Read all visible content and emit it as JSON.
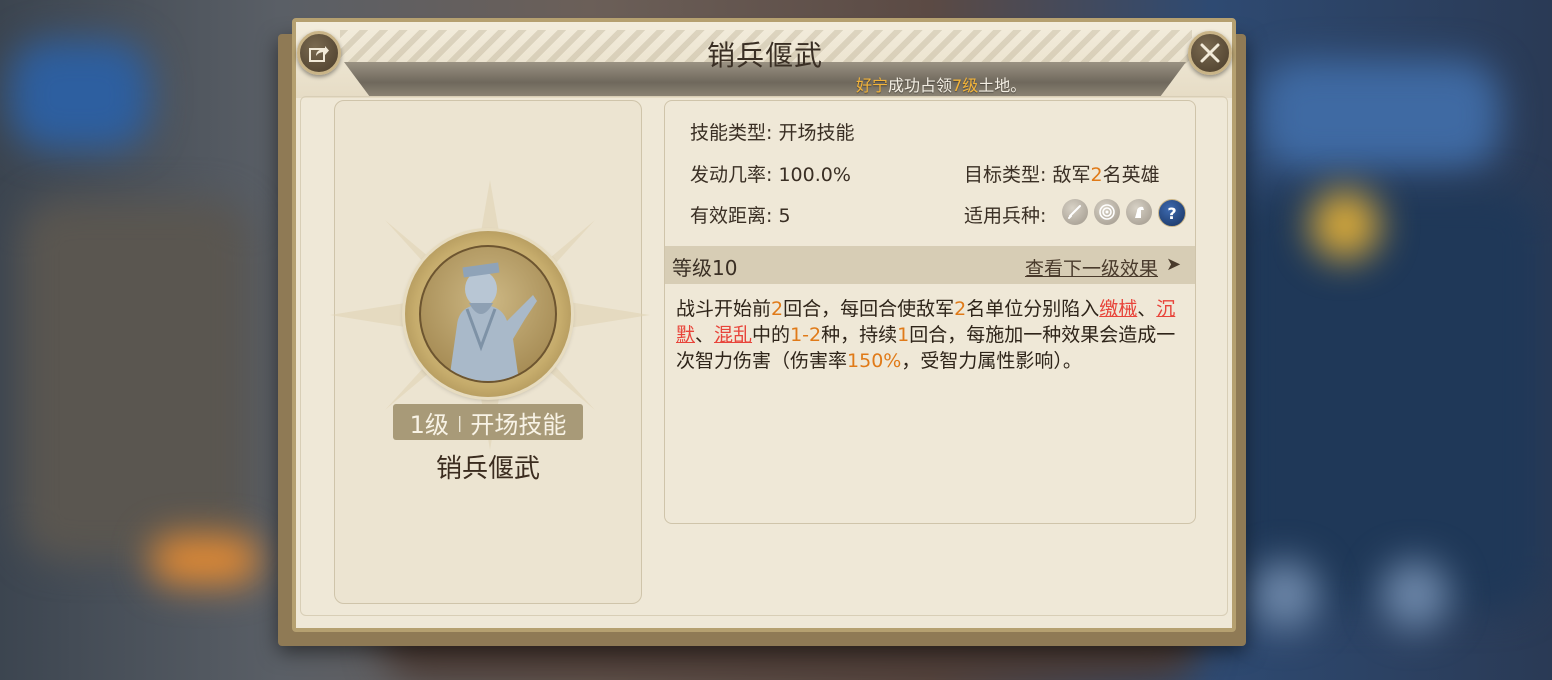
{
  "window": {
    "title": "销兵偃武"
  },
  "notice": {
    "player": "好宁",
    "text_mid": "成功占领",
    "level": "7级",
    "text_end": "土地。"
  },
  "skill": {
    "level_tag": "1级",
    "separator": "|",
    "type_tag": "开场技能",
    "name": "销兵偃武"
  },
  "attributes": {
    "skill_type_label": "技能类型:",
    "skill_type_value": "开场技能",
    "trigger_rate_label": "发动几率:",
    "trigger_rate_value": "100.0%",
    "target_type_label": "目标类型:",
    "target_prefix": "敌军",
    "target_count": "2",
    "target_suffix": "名英雄",
    "range_label": "有效距离:",
    "range_value": "5",
    "troop_label": "适用兵种:",
    "troop_icons": [
      "sword-icon",
      "bow-target-icon",
      "horse-icon",
      "question-icon"
    ],
    "question_glyph": "?"
  },
  "level_section": {
    "label": "等级10",
    "next_link": "查看下一级效果",
    "arrow": "➤"
  },
  "description": {
    "p1": "战斗开始前",
    "n1": "2",
    "p2": "回合，每回合使敌军",
    "n2": "2",
    "p3": "名单位分别陷入",
    "s1": "缴械",
    "p4": "、",
    "s2": "沉默",
    "p5": "、",
    "s3": "混乱",
    "p6": "中的",
    "n3": "1-2",
    "p7": "种，持续",
    "n4": "1",
    "p8": "回合，每施加一种效果会造成一次智力伤害（伤害率",
    "n5": "150%",
    "p9": "，受智力属性影响）。"
  },
  "colors": {
    "highlight_number": "#e07a18",
    "status_effect": "#e8443a",
    "notice_highlight": "#f3b43a"
  }
}
